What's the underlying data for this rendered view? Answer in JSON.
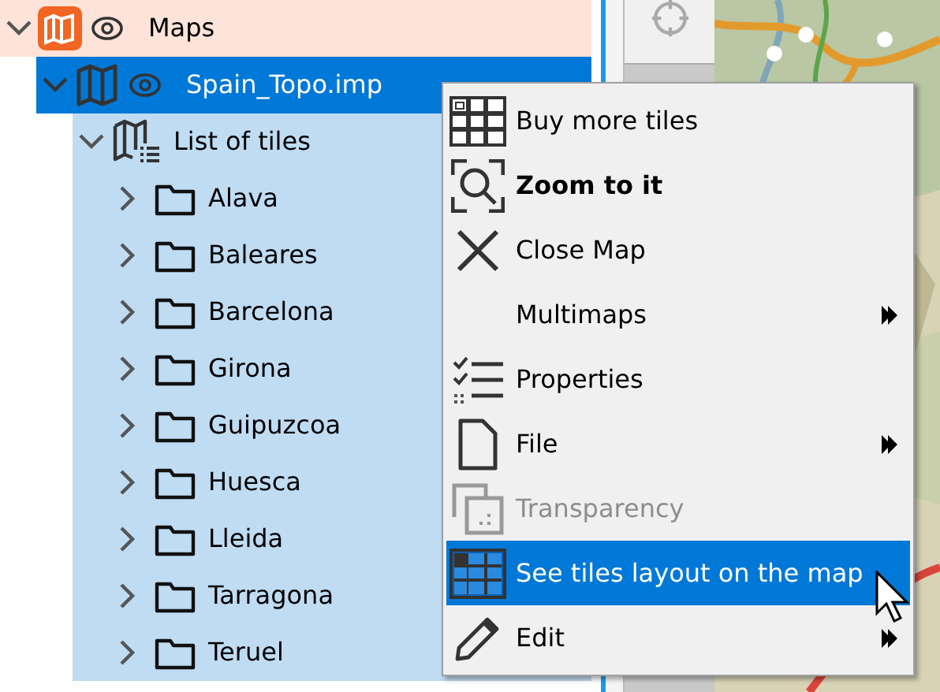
{
  "tree": [
    {
      "label": "Maps",
      "kind": "maps-root",
      "visible": true,
      "expanded": true,
      "selected": false,
      "children": [
        {
          "label": "Spain_Topo.imp",
          "kind": "map",
          "visible": true,
          "expanded": true,
          "selected": true,
          "children": [
            {
              "label": "List of tiles",
              "kind": "tile-list",
              "expanded": true,
              "selected": false,
              "children": [
                {
                  "label": "Alava",
                  "kind": "folder",
                  "expanded": false,
                  "selected": false
                },
                {
                  "label": "Baleares",
                  "kind": "folder",
                  "expanded": false,
                  "selected": false
                },
                {
                  "label": "Barcelona",
                  "kind": "folder",
                  "expanded": false,
                  "selected": false
                },
                {
                  "label": "Girona",
                  "kind": "folder",
                  "expanded": false,
                  "selected": false
                },
                {
                  "label": "Guipuzcoa",
                  "kind": "folder",
                  "expanded": false,
                  "selected": false
                },
                {
                  "label": "Huesca",
                  "kind": "folder",
                  "expanded": false,
                  "selected": false
                },
                {
                  "label": "Lleida",
                  "kind": "folder",
                  "expanded": false,
                  "selected": false
                },
                {
                  "label": "Tarragona",
                  "kind": "folder",
                  "expanded": false,
                  "selected": false
                },
                {
                  "label": "Teruel",
                  "kind": "folder",
                  "expanded": false,
                  "selected": false
                }
              ]
            }
          ]
        }
      ]
    }
  ],
  "context_menu": [
    {
      "label": "Buy more tiles",
      "kind": "grid",
      "bold": false,
      "disabled": false,
      "highlighted": false,
      "submenu": false
    },
    {
      "label": "Zoom to it",
      "kind": "zoom",
      "bold": true,
      "disabled": false,
      "highlighted": false,
      "submenu": false
    },
    {
      "label": "Close Map",
      "kind": "close",
      "bold": false,
      "disabled": false,
      "highlighted": false,
      "submenu": false
    },
    {
      "label": "Multimaps",
      "kind": "plain",
      "bold": false,
      "disabled": false,
      "highlighted": false,
      "submenu": true
    },
    {
      "label": "Properties",
      "kind": "checklist",
      "bold": false,
      "disabled": false,
      "highlighted": false,
      "submenu": false
    },
    {
      "label": "File",
      "kind": "file",
      "bold": false,
      "disabled": false,
      "highlighted": false,
      "submenu": true
    },
    {
      "label": "Transparency",
      "kind": "transparency",
      "bold": false,
      "disabled": true,
      "highlighted": false,
      "submenu": false
    },
    {
      "label": "See tiles layout on the map",
      "kind": "grid",
      "bold": false,
      "disabled": false,
      "highlighted": true,
      "submenu": false
    },
    {
      "label": "Edit",
      "kind": "pencil",
      "bold": false,
      "disabled": false,
      "highlighted": false,
      "submenu": true
    }
  ]
}
